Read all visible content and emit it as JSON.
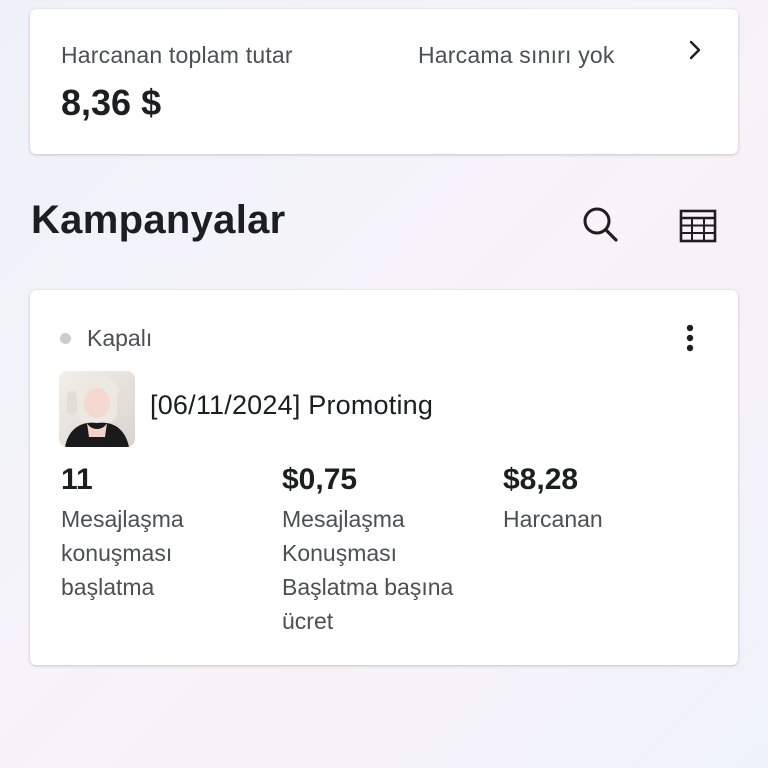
{
  "spend_summary": {
    "label": "Harcanan toplam tutar",
    "value": "8,36 $",
    "limit": "Harcama sınırı yok"
  },
  "campaigns_section": {
    "title": "Kampanyalar"
  },
  "icons": {
    "chevron": "chevron-right-icon",
    "search": "search-icon",
    "table": "table-icon",
    "more": "more-vertical-icon"
  },
  "campaign": {
    "status": "Kapalı",
    "name": "[06/11/2024] Promoting",
    "metrics": [
      {
        "value": "11",
        "label": "Mesajlaşma konuşması başlatma"
      },
      {
        "value": "$0,75",
        "label": "Mesajlaşma Konuşması Başlatma başına ücret"
      },
      {
        "value": "$8,28",
        "label": "Harcanan"
      }
    ]
  },
  "colors": {
    "text_primary": "#1c1e21",
    "text_secondary": "#4b4f56",
    "status_off": "#c9ccd1",
    "card_bg": "#ffffff"
  }
}
